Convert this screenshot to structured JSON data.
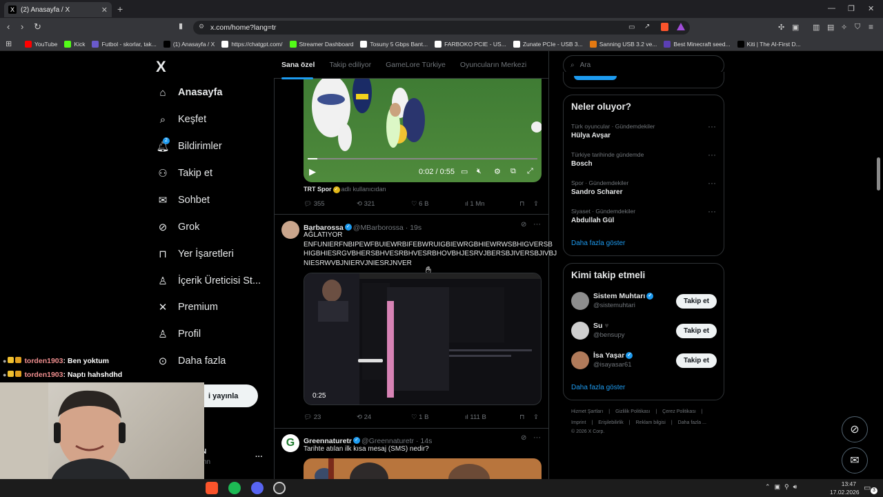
{
  "browser": {
    "tab_title": "(2) Anasayfa / X",
    "tab_close": "✕",
    "new_tab": "+",
    "url": "x.com/home?lang=tr",
    "bookmarks": [
      {
        "label": "YouTube",
        "color": "#ff0000"
      },
      {
        "label": "Kick",
        "color": "#53fc18"
      },
      {
        "label": "Futbol - skorlar, tak...",
        "color": "#6a5acd"
      },
      {
        "label": "(1) Anasayfa / X",
        "color": "#000000"
      },
      {
        "label": "https://chatgpt.com/",
        "color": "#ffffff"
      },
      {
        "label": "Streamer Dashboard",
        "color": "#53fc18"
      },
      {
        "label": "Tosuny 5 Gbps Bant...",
        "color": "#ffffff"
      },
      {
        "label": "FARBOKO PCIE - US...",
        "color": "#ffffff"
      },
      {
        "label": "Zunate PCIe - USB 3...",
        "color": "#ffffff"
      },
      {
        "label": "Sanning USB 3.2 ve...",
        "color": "#e47911"
      },
      {
        "label": "Best Minecraft seed...",
        "color": "#5b3fb5"
      },
      {
        "label": "Kiti | The AI-First D...",
        "color": "#000000"
      }
    ]
  },
  "sidebar": {
    "logo": "X",
    "items": [
      {
        "label": "Anasayfa",
        "icon": "home-icon"
      },
      {
        "label": "Keşfet",
        "icon": "search-icon"
      },
      {
        "label": "Bildirimler",
        "icon": "bell-icon",
        "badge": "2"
      },
      {
        "label": "Takip et",
        "icon": "follow-icon"
      },
      {
        "label": "Sohbet",
        "icon": "mail-icon"
      },
      {
        "label": "Grok",
        "icon": "grok-icon"
      },
      {
        "label": "Yer İşaretleri",
        "icon": "bookmark-icon"
      },
      {
        "label": "İçerik Üreticisi St...",
        "icon": "creator-icon"
      },
      {
        "label": "Premium",
        "icon": "premium-icon"
      },
      {
        "label": "Profil",
        "icon": "profile-icon"
      },
      {
        "label": "Daha fazla",
        "icon": "more-icon"
      }
    ],
    "post_button": "i yayınla",
    "account_initial": "N",
    "account_handle_fragment": "nn",
    "account_more": "···"
  },
  "feed": {
    "tabs": [
      "Sana özel",
      "Takip ediliyor",
      "GameLore Türkiye",
      "Oyuncuların Merkezi"
    ],
    "video1": {
      "time": "0:02 / 0:55",
      "source_name": "TRT Spor",
      "source_suffix": "adlı kullanıcıdan",
      "replies": "355",
      "reposts": "321",
      "likes": "6 B",
      "views": "1 Mn"
    },
    "tweet2": {
      "name": "Barbarossa",
      "handle": "@MBarborossa · 19s",
      "line1": "AĞLATIYOR",
      "line2": "ENFUNIERFNBIPEWFBUIEWRBIFEBWRUIGBIEWRGBHIEWRWSBHIGVERSB",
      "line3": "HIGBHIESRGVBHERSBHVESRBHVESRBHOVBHJESRVJBERSBJIVERSBJIVBJ",
      "line4": "NIESRWVBJNIERVJNIESRJNVER",
      "video_time": "0:25",
      "replies": "23",
      "reposts": "24",
      "likes": "1 B",
      "views": "111 B"
    },
    "tweet3": {
      "name": "Greennaturetr",
      "handle": "@Greennaturetr · 14s",
      "text": "Tarihte atılan ilk kısa mesaj (SMS) nedir?"
    }
  },
  "right": {
    "search_placeholder": "Ara",
    "trends_title": "Neler oluyor?",
    "trends": [
      {
        "meta": "Türk oyuncular · Gündemdekiler",
        "name": "Hülya Avşar"
      },
      {
        "meta": "Türkiye tarihinde gündemde",
        "name": "Bosch"
      },
      {
        "meta": "Spor · Gündemdekiler",
        "name": "Sandro Scharer"
      },
      {
        "meta": "Siyaset · Gündemdekiler",
        "name": "Abdullah Gül"
      }
    ],
    "trends_more": "Daha fazla göster",
    "who_title": "Kimi takip etmeli",
    "who": [
      {
        "name": "Sistem Muhtarı",
        "handle": "@sistemuhtari",
        "verified": true,
        "heart": false
      },
      {
        "name": "Su",
        "handle": "@bensupy",
        "verified": false,
        "heart": true
      },
      {
        "name": "İsa Yaşar",
        "handle": "@isayasar61",
        "verified": true,
        "heart": false
      }
    ],
    "follow_label": "Takip et",
    "who_more": "Daha fazla göster",
    "footer_row1": [
      "Hizmet Şartları",
      "Gizlilik Politikası",
      "Çerez Politikası"
    ],
    "footer_row2": [
      "Imprint",
      "Erişilebilirlik",
      "Reklam bilgisi",
      "Daha fazla ..."
    ],
    "copyright": "© 2026 X Corp."
  },
  "chat": [
    {
      "user": "torden1903",
      "msg": ": Ben yoktum"
    },
    {
      "user": "torden1903",
      "msg": ": Naptı hahshdhd"
    }
  ],
  "taskbar": {
    "time": "13:47",
    "date": "17.02.2026",
    "notif": "3"
  }
}
